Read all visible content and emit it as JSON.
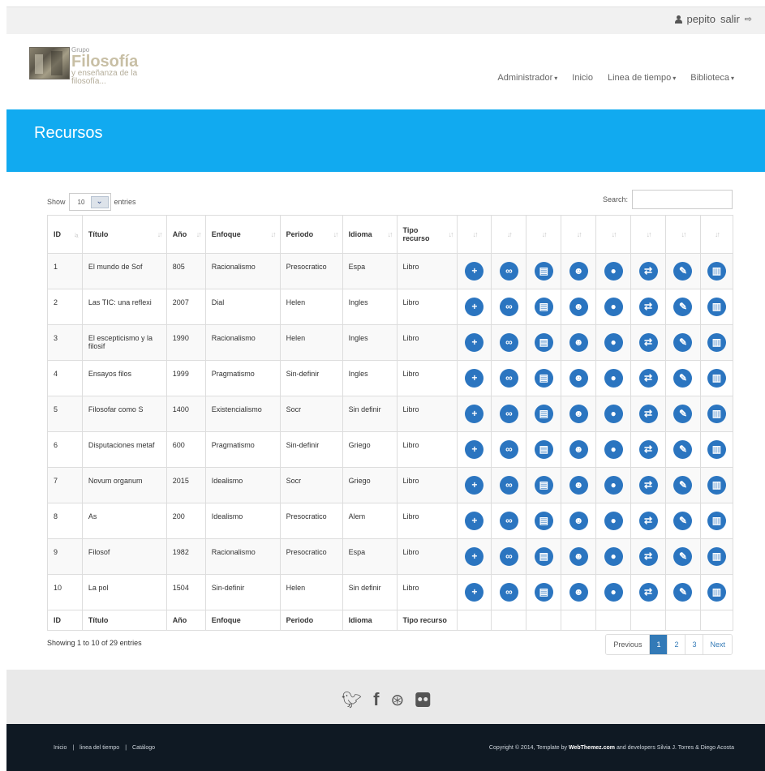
{
  "user": {
    "name": "pepito",
    "logout": "salir"
  },
  "logo": {
    "small": "Grupo",
    "big": "Filosofía",
    "sub1": "y enseñanza de la",
    "sub2": "filosofía..."
  },
  "nav": [
    {
      "label": "Administrador",
      "dropdown": true
    },
    {
      "label": "Inicio",
      "dropdown": false
    },
    {
      "label": "Linea de tiempo",
      "dropdown": true
    },
    {
      "label": "Biblioteca",
      "dropdown": true
    }
  ],
  "banner": {
    "title": "Recursos"
  },
  "controls": {
    "show_label": "Show",
    "show_value": "10",
    "entries_label": "entries",
    "search_label": "Search:"
  },
  "table": {
    "headers": [
      "ID",
      "Título",
      "Año",
      "Enfoque",
      "Periodo",
      "Idioma",
      "Tipo recurso"
    ],
    "footer": [
      "ID",
      "Título",
      "Año",
      "Enfoque",
      "Periodo",
      "Idioma",
      "Tipo recurso"
    ],
    "rows": [
      [
        "1",
        "El mundo de Sof",
        "805",
        "Racionalismo",
        "Presocratico",
        "Espa",
        "Libro"
      ],
      [
        "2",
        "Las TIC: una reflexi",
        "2007",
        "Dial",
        "Helen",
        "Ingles",
        "Libro"
      ],
      [
        "3",
        "El escepticismo y la filosif",
        "1990",
        "Racionalismo",
        "Helen",
        "Ingles",
        "Libro"
      ],
      [
        "4",
        "Ensayos filos",
        "1999",
        "Pragmatismo",
        "Sin-definir",
        "Ingles",
        "Libro"
      ],
      [
        "5",
        "Filosofar como S",
        "1400",
        "Existencialismo",
        "Socr",
        "Sin definir",
        "Libro"
      ],
      [
        "6",
        "Disputaciones metaf",
        "600",
        "Pragmatismo",
        "Sin-definir",
        "Griego",
        "Libro"
      ],
      [
        "7",
        "Novum organum",
        "2015",
        "Idealismo",
        "Socr",
        "Griego",
        "Libro"
      ],
      [
        "8",
        "As",
        "200",
        "Idealismo",
        "Presocratico",
        "Alem",
        "Libro"
      ],
      [
        "9",
        "Filosof",
        "1982",
        "Racionalismo",
        "Presocratico",
        "Espa",
        "Libro"
      ],
      [
        "10",
        "La pol",
        "1504",
        "Sin-definir",
        "Helen",
        "Sin definir",
        "Libro"
      ]
    ],
    "actions": [
      "plus-icon",
      "link-icon",
      "book-icon",
      "users-icon",
      "comment-icon",
      "exchange-icon",
      "wrench-icon",
      "trash-icon"
    ]
  },
  "info": "Showing 1 to 10 of 29 entries",
  "pager": {
    "previous": "Previous",
    "pages": [
      "1",
      "2",
      "3"
    ],
    "next": "Next",
    "active": "1"
  },
  "social": [
    "twitter-icon",
    "facebook-icon",
    "dribbble-icon",
    "flickr-icon"
  ],
  "footer": {
    "links": [
      "Inicio",
      "|",
      "linea del tiempo",
      "|",
      "Catálogo"
    ],
    "copy_prefix": "Copyright © 2014, Template by",
    "copy_brand": "WebThemez.com",
    "copy_suffix": "and developers Silvia J. Torres & Diego Acosta"
  },
  "colors": {
    "banner": "#11aaf0",
    "action_button": "#2b75c0",
    "footer_bg": "#0f1923"
  }
}
